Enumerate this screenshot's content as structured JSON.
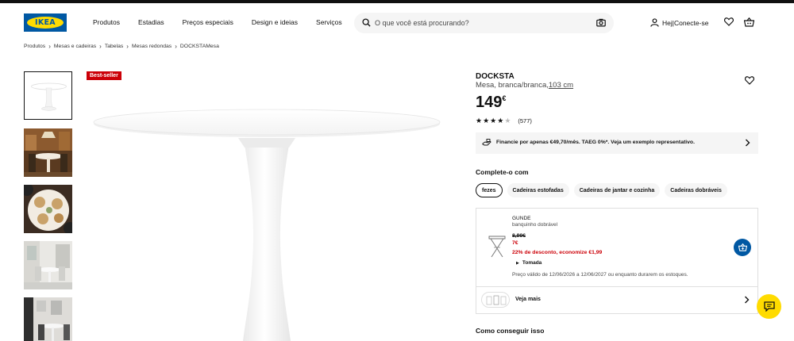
{
  "header": {
    "logo_text": "IKEA",
    "nav": [
      "Produtos",
      "Estadias",
      "Preços especiais",
      "Design e ideias",
      "Serviços"
    ],
    "search_placeholder": "O que você está procurando?",
    "user_label": "Hej|Conecte-se"
  },
  "breadcrumb": [
    "Produtos",
    "Mesas e cadeiras",
    "Tabelas",
    "Mesas redondas",
    "DOCKSTAMesa"
  ],
  "gallery": {
    "badge": "Best-seller",
    "thumb_count": 5,
    "selected_thumb": 0
  },
  "product": {
    "name": "DOCKSTA",
    "desc": "Mesa, branca/branca,",
    "size": "103 cm",
    "price": "149",
    "currency": "€",
    "rating": 4,
    "rating_max": 5,
    "review_count": "(577)",
    "finance_text": "Financie por apenas €49,70/mês. TAEG 0%*. Veja um exemplo representativo."
  },
  "complete": {
    "title": "Complete-o com",
    "chips": [
      "fezes",
      "Cadeiras estofadas",
      "Cadeiras de jantar e cozinha",
      "Cadeiras dobráveis"
    ],
    "active_chip": 0
  },
  "recommendation": {
    "brand": "GUNDE",
    "desc": "banquinho dobrável",
    "old_price": "8,99€",
    "new_price": "7€",
    "discount": "22% de desconto, economize €1,99",
    "tomada": "Tomada",
    "validity": "Preço válido de 12/06/2026 a 12/06/2027 ou enquanto durarem os estoques.",
    "see_more": "Veja mais"
  },
  "how_to_get": "Como conseguir isso",
  "colors": {
    "brand_blue": "#0058a3",
    "brand_yellow": "#ffdb00",
    "sale_red": "#cc0008"
  },
  "icons": [
    "search-icon",
    "camera-icon",
    "user-icon",
    "heart-icon",
    "basket-icon",
    "chevron-right-icon",
    "finance-icon",
    "add-to-cart-icon",
    "chat-icon"
  ]
}
